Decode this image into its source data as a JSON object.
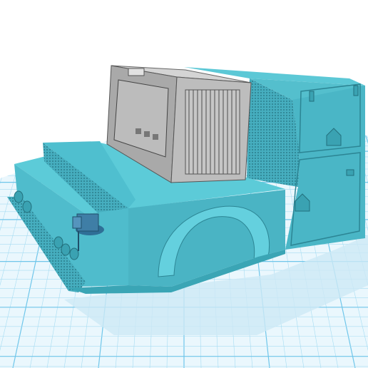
{
  "viewport": {
    "background_color": "#ffffff",
    "grid_color": "#6fc6ea",
    "grid_minor_color": "#a6dcf2",
    "model_color": "#4fbfcf",
    "model_shadow_color": "#2e95a6",
    "generator_color": "#b9b9b9",
    "vise_color": "#3f7ea6"
  },
  "scene": {
    "objects": [
      {
        "name": "workplane-grid",
        "icon": "grid-icon"
      },
      {
        "name": "flatbed-body",
        "icon": "truck-bed-icon"
      },
      {
        "name": "welder-generator",
        "icon": "generator-icon"
      },
      {
        "name": "toolbox-side-compartment",
        "icon": "toolbox-icon"
      },
      {
        "name": "bench-vise",
        "icon": "vise-icon"
      },
      {
        "name": "diamond-plate-bumper",
        "icon": "plate-icon"
      }
    ]
  }
}
